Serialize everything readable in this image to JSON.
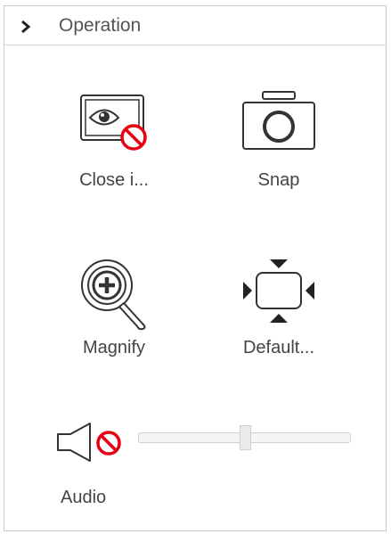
{
  "panel": {
    "title": "Operation",
    "expand_icon": "chevron-right-icon"
  },
  "tools": [
    {
      "label": "Close i...",
      "icon": "close-image-icon"
    },
    {
      "label": "Snap",
      "icon": "camera-icon"
    },
    {
      "label": "Magnify",
      "icon": "magnify-icon"
    },
    {
      "label": "Default...",
      "icon": "default-view-icon"
    }
  ],
  "audio": {
    "label": "Audio",
    "icon": "speaker-muted-icon",
    "volume": 0.5
  },
  "colors": {
    "mute_red": "#e60012",
    "icon_stroke": "#333333",
    "border": "#c8c8c8"
  }
}
